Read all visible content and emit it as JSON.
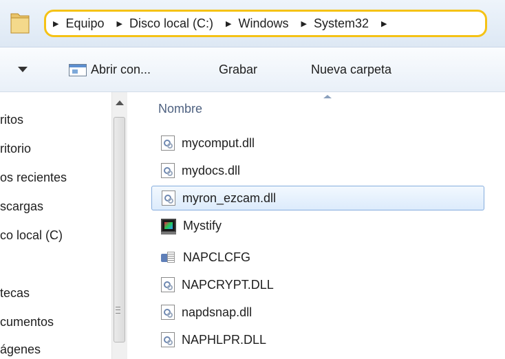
{
  "address_bar": {
    "crumbs": [
      "Equipo",
      "Disco local (C:)",
      "Windows",
      "System32"
    ]
  },
  "toolbar": {
    "open_with_label": "Abrir con...",
    "burn_label": "Grabar",
    "new_folder_label": "Nueva carpeta"
  },
  "nav": {
    "items": [
      "ritos",
      "ritorio",
      "os recientes",
      "scargas",
      "co local (C)",
      "tecas",
      "cumentos",
      "ágenes"
    ]
  },
  "files": {
    "column_header": "Nombre",
    "rows": [
      {
        "name": "mycomput.dll",
        "icon": "dll-file-icon",
        "selected": false
      },
      {
        "name": "mydocs.dll",
        "icon": "dll-file-icon",
        "selected": false
      },
      {
        "name": "myron_ezcam.dll",
        "icon": "dll-file-icon",
        "selected": true
      },
      {
        "name": "Mystify",
        "icon": "screensaver-icon",
        "selected": false
      },
      {
        "name": "NAPCLCFG",
        "icon": "config-app-icon",
        "selected": false
      },
      {
        "name": "NAPCRYPT.DLL",
        "icon": "dll-file-icon",
        "selected": false
      },
      {
        "name": "napdsnap.dll",
        "icon": "dll-file-icon",
        "selected": false
      },
      {
        "name": "NAPHLPR.DLL",
        "icon": "dll-file-icon",
        "selected": false
      }
    ]
  },
  "colors": {
    "highlight_border": "#f5c215",
    "selection_border": "#84acdd",
    "column_header": "#4f6281"
  }
}
